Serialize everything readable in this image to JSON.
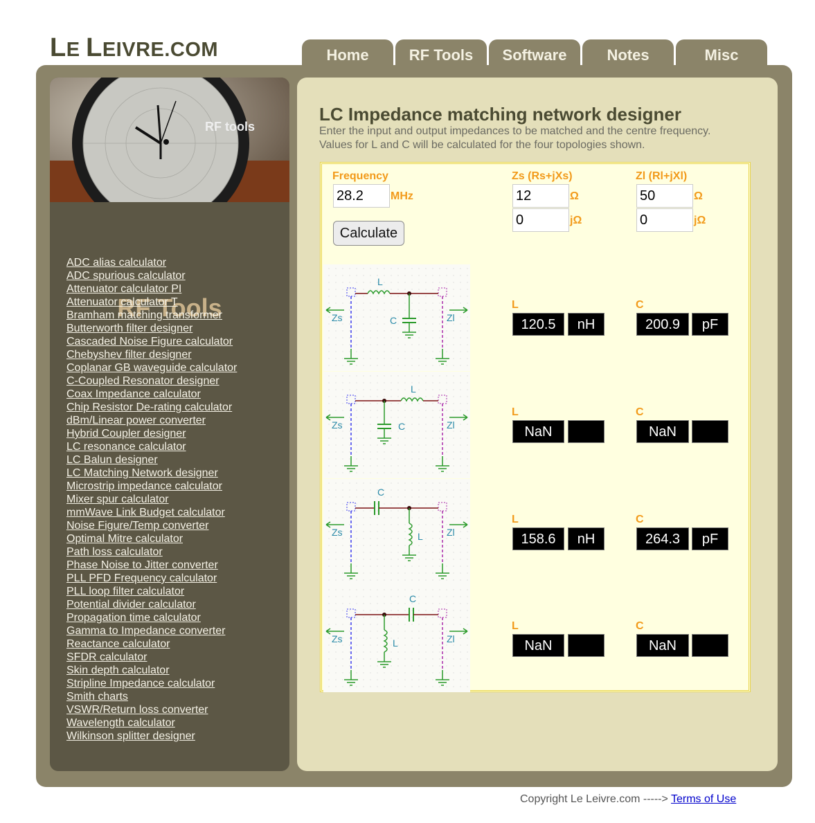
{
  "site": {
    "title_cap1": "L",
    "title_rest1": "E ",
    "title_cap2": "L",
    "title_rest2": "EIVRE.COM"
  },
  "nav": [
    "Home",
    "RF Tools",
    "Software",
    "Notes",
    "Misc"
  ],
  "sidebar": {
    "banner_text": "RF tools",
    "title": "RF Tools",
    "links": [
      "ADC alias calculator",
      "ADC spurious calculator",
      "Attenuator calculator PI",
      "Attenuator calculator T",
      "Bramham matching transformer",
      "Butterworth filter designer",
      "Cascaded Noise Figure calculator",
      "Chebyshev filter designer",
      "Coplanar GB waveguide calculator",
      "C-Coupled Resonator designer",
      "Coax Impedance calculator",
      "Chip Resistor De-rating calculator",
      "dBm/Linear power converter",
      "Hybrid Coupler designer",
      "LC resonance calculator",
      "LC Balun designer",
      "LC Matching Network designer",
      "Microstrip impedance calculator",
      "Mixer spur calculator",
      "mmWave Link Budget calculator",
      "Noise Figure/Temp converter",
      "Optimal Mitre calculator",
      "Path loss calculator",
      "Phase Noise to Jitter converter",
      "PLL PFD Frequency calculator",
      "PLL loop filter calculator",
      "Potential divider calculator",
      "Propagation time calculator",
      "Gamma to Impedance converter",
      "Reactance calculator",
      "SFDR calculator",
      "Skin depth calculator",
      "Stripline Impedance calculator",
      "Smith charts",
      "VSWR/Return loss converter",
      "Wavelength calculator",
      "Wilkinson splitter designer"
    ]
  },
  "main": {
    "title": "LC Impedance matching network designer",
    "desc1": "Enter the input and output impedances to be matched and the centre frequency.",
    "desc2": "Values for L and C will be calculated for the four topologies shown."
  },
  "form": {
    "freq_label": "Frequency",
    "freq_value": "28.2",
    "freq_unit": "MHz",
    "zs_label": "Zs (Rs+jXs)",
    "zs_r": "12",
    "zs_x": "0",
    "zl_label": "Zl (Rl+jXl)",
    "zl_r": "50",
    "zl_x": "0",
    "ohm": "Ω",
    "johm": "jΩ",
    "calculate": "Calculate"
  },
  "schematic": {
    "zs": "Zs",
    "zl": "Zl",
    "l": "L",
    "c": "C"
  },
  "results": [
    {
      "l_label": "L",
      "l_value": "120.5",
      "l_unit": "nH",
      "c_label": "C",
      "c_value": "200.9",
      "c_unit": "pF"
    },
    {
      "l_label": "L",
      "l_value": "NaN",
      "l_unit": "",
      "c_label": "C",
      "c_value": "NaN",
      "c_unit": ""
    },
    {
      "l_label": "L",
      "l_value": "158.6",
      "l_unit": "nH",
      "c_label": "C",
      "c_value": "264.3",
      "c_unit": "pF"
    },
    {
      "l_label": "L",
      "l_value": "NaN",
      "l_unit": "",
      "c_label": "C",
      "c_value": "NaN",
      "c_unit": ""
    }
  ],
  "footer": {
    "text": "Copyright Le Leivre.com -----> ",
    "link": "Terms of Use"
  }
}
